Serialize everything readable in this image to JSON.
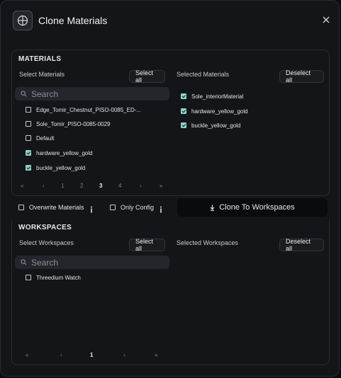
{
  "dialog": {
    "title": "Clone Materials"
  },
  "materials": {
    "section_title": "MATERIALS",
    "select_label": "Select Materials",
    "select_all": "Select all",
    "selected_label": "Selected Materials",
    "deselect_all": "Deselect all",
    "search_placeholder": "Search",
    "items": [
      {
        "label": "Edge_Tomir_Chestnut_PISO-0085_ED-...",
        "checked": false
      },
      {
        "label": "Sole_Tomir_PISO-0085-0029",
        "checked": false
      },
      {
        "label": "Default",
        "checked": false
      },
      {
        "label": "hardware_yellow_gold",
        "checked": true
      },
      {
        "label": "buckle_yellow_gold",
        "checked": true
      }
    ],
    "selected_items": [
      {
        "label": "Sole_interiorMaterial",
        "checked": true
      },
      {
        "label": "hardware_yellow_gold",
        "checked": true
      },
      {
        "label": "buckle_yellow_gold",
        "checked": true
      }
    ],
    "pagination": {
      "first": "«",
      "prev": "‹",
      "pages": [
        "1",
        "2",
        "3",
        "4"
      ],
      "current": "3",
      "next": "›",
      "last": "»"
    }
  },
  "options": {
    "overwrite_label": "Overwrite Materials",
    "overwrite_checked": false,
    "only_config_label": "Only Config",
    "only_config_checked": false,
    "clone_button": "Clone To Workspaces"
  },
  "workspaces": {
    "section_title": "WORKSPACES",
    "select_label": "Select Workspaces",
    "select_all": "Select all",
    "selected_label": "Selected Workspaces",
    "deselect_all": "Deselect all",
    "search_placeholder": "Search",
    "items": [
      {
        "label": "Threedium Watch",
        "checked": false
      }
    ],
    "pagination": {
      "first": "«",
      "prev": "‹",
      "pages": [
        "1"
      ],
      "current": "1",
      "next": "›",
      "last": "»"
    }
  },
  "colors": {
    "accent_checkbox": "#8fd1cc",
    "panel_bg": "#141518",
    "border": "#2a2c31"
  },
  "icons": [
    "globe-icon",
    "close-icon",
    "search-icon",
    "info-icon",
    "download-icon"
  ]
}
